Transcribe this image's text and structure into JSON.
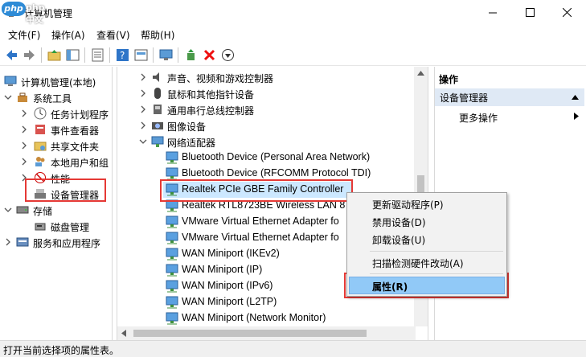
{
  "window": {
    "title": "计算机管理",
    "watermark": "php 中文网"
  },
  "menu": [
    "文件(F)",
    "操作(A)",
    "查看(V)",
    "帮助(H)"
  ],
  "left_tree": [
    {
      "label": "计算机管理(本地)",
      "level": 0,
      "expander": "none"
    },
    {
      "label": "系统工具",
      "level": 1,
      "expander": "open"
    },
    {
      "label": "任务计划程序",
      "level": 2,
      "expander": "closed"
    },
    {
      "label": "事件查看器",
      "level": 2,
      "expander": "closed"
    },
    {
      "label": "共享文件夹",
      "level": 2,
      "expander": "closed"
    },
    {
      "label": "本地用户和组",
      "level": 2,
      "expander": "closed"
    },
    {
      "label": "性能",
      "level": 2,
      "expander": "closed"
    },
    {
      "label": "设备管理器",
      "level": 2,
      "expander": "none"
    },
    {
      "label": "存储",
      "level": 1,
      "expander": "open"
    },
    {
      "label": "磁盘管理",
      "level": 2,
      "expander": "none"
    },
    {
      "label": "服务和应用程序",
      "level": 1,
      "expander": "closed"
    }
  ],
  "device_tree": [
    {
      "label": "声音、视频和游戏控制器",
      "type": "category",
      "expander": "closed"
    },
    {
      "label": "鼠标和其他指针设备",
      "type": "category",
      "expander": "closed"
    },
    {
      "label": "通用串行总线控制器",
      "type": "category",
      "expander": "closed"
    },
    {
      "label": "图像设备",
      "type": "category",
      "expander": "closed"
    },
    {
      "label": "网络适配器",
      "type": "category",
      "expander": "open"
    },
    {
      "label": "Bluetooth Device (Personal Area Network)",
      "type": "device"
    },
    {
      "label": "Bluetooth Device (RFCOMM Protocol TDI)",
      "type": "device"
    },
    {
      "label": "Realtek PCIe GBE Family Controller",
      "type": "device",
      "selected": true
    },
    {
      "label": "Realtek RTL8723BE Wireless LAN 8",
      "type": "device"
    },
    {
      "label": "VMware Virtual Ethernet Adapter fo",
      "type": "device"
    },
    {
      "label": "VMware Virtual Ethernet Adapter fo",
      "type": "device"
    },
    {
      "label": "WAN Miniport (IKEv2)",
      "type": "device"
    },
    {
      "label": "WAN Miniport (IP)",
      "type": "device"
    },
    {
      "label": "WAN Miniport (IPv6)",
      "type": "device"
    },
    {
      "label": "WAN Miniport (L2TP)",
      "type": "device"
    },
    {
      "label": "WAN Miniport (Network Monitor)",
      "type": "device"
    }
  ],
  "actions": {
    "header": "操作",
    "section": "设备管理器",
    "more": "更多操作"
  },
  "context_menu": {
    "update_driver": "更新驱动程序(P)",
    "disable": "禁用设备(D)",
    "uninstall": "卸载设备(U)",
    "scan": "扫描检测硬件改动(A)",
    "properties": "属性(R)"
  },
  "status": "打开当前选择项的属性表。",
  "colors": {
    "highlight_box": "#e53935",
    "selection": "#cce8ff",
    "menu_highlight": "#91c9f7",
    "accent_blue": "#2e8bd6"
  }
}
